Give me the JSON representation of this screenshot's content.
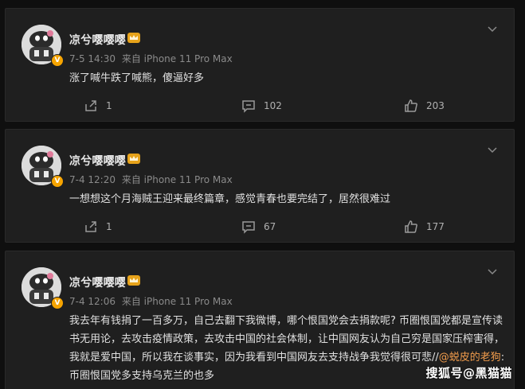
{
  "posts": [
    {
      "user": "凉兮嘤嘤嘤",
      "date": "7-5 14:30",
      "source": "来自 iPhone 11 Pro Max",
      "text": "涨了喊牛跌了喊熊，傻逼好多",
      "shares": "1",
      "comments": "102",
      "likes": "203"
    },
    {
      "user": "凉兮嘤嘤嘤",
      "date": "7-4 12:20",
      "source": "来自 iPhone 11 Pro Max",
      "text": "一想想这个月海贼王迎来最终篇章，感觉青春也要完结了，居然很难过",
      "shares": "1",
      "comments": "67",
      "likes": "177"
    },
    {
      "user": "凉兮嘤嘤嘤",
      "date": "7-4 12:06",
      "source": "来自 iPhone 11 Pro Max",
      "text_part1": "我去年有钱捐了一百多万，自己去翻下我微博，哪个恨国党会去捐款呢? 币圈恨国党都是宣传读书无用论，去攻击疫情政策，去攻击中国的社会体制，让中国网友认为自己穷是国家压榨害得，我就是爱中国，所以我在谈事实，因为我看到中国网友去支持战争我觉得很可悲//",
      "mention": "@蜕皮的老狗",
      "text_part2": ":币圈恨国党多支持乌克兰的也多"
    }
  ],
  "watermark": "搜狐号@黑猫猫",
  "icons": {
    "share": "share-icon",
    "comment": "comment-icon",
    "like": "thumbs-up-icon",
    "menu": "chevron-down-icon",
    "crown": "crown-badge-icon",
    "verified": "verified-badge-icon"
  },
  "colors": {
    "background": "#0f0f0f",
    "card": "#1f1f1f",
    "mention": "#f19c4c",
    "verified": "#f6a400"
  }
}
